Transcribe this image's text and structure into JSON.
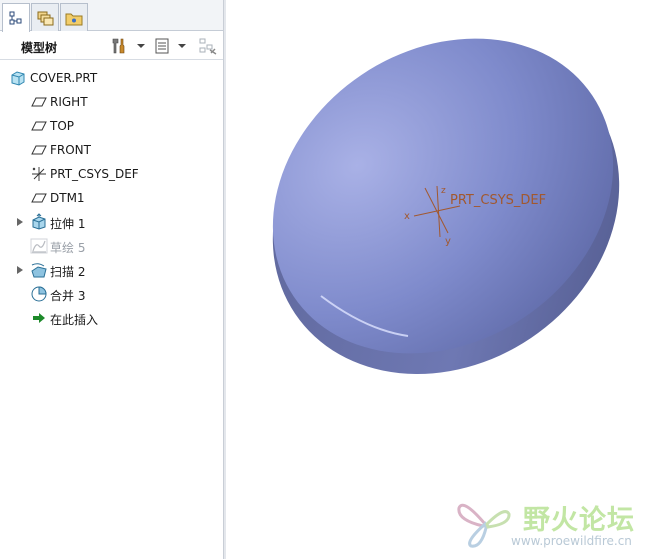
{
  "navigator": {
    "tabs": [
      {
        "icon": "model-tree-icon",
        "active": true
      },
      {
        "icon": "layers-icon",
        "active": false
      },
      {
        "icon": "favorites-folder-icon",
        "active": false
      }
    ],
    "toolbar": {
      "title": "模型树",
      "settings_icon": "tools-icon",
      "show_icon": "tree-columns-icon",
      "filter_icon": "tree-filter-icon"
    }
  },
  "tree": {
    "items": [
      {
        "label": "COVER.PRT",
        "icon": "part-icon",
        "expandable": false,
        "dim": false
      },
      {
        "label": "RIGHT",
        "icon": "datum-plane-icon",
        "expandable": false,
        "dim": false
      },
      {
        "label": "TOP",
        "icon": "datum-plane-icon",
        "expandable": false,
        "dim": false
      },
      {
        "label": "FRONT",
        "icon": "datum-plane-icon",
        "expandable": false,
        "dim": false
      },
      {
        "label": "PRT_CSYS_DEF",
        "icon": "coordinate-system-icon",
        "expandable": false,
        "dim": false
      },
      {
        "label": "DTM1",
        "icon": "datum-plane-icon",
        "expandable": false,
        "dim": false
      },
      {
        "label": "拉伸 1",
        "icon": "extrude-icon",
        "expandable": true,
        "dim": false
      },
      {
        "label": "草绘 5",
        "icon": "sketch-icon",
        "expandable": false,
        "dim": true
      },
      {
        "label": "扫描 2",
        "icon": "sweep-icon",
        "expandable": true,
        "dim": false
      },
      {
        "label": "合并 3",
        "icon": "merge-icon",
        "expandable": false,
        "dim": false
      },
      {
        "label": "在此插入",
        "icon": "insert-here-arrow-icon",
        "expandable": false,
        "dim": false
      }
    ]
  },
  "viewport": {
    "csys_label": "PRT_CSYS_DEF",
    "axis_x": "x",
    "axis_y": "y",
    "axis_z": "z",
    "model_color": "#7b87c8",
    "csys_color": "#a2582e"
  },
  "watermark": {
    "name": "野火论坛",
    "url": "www.proewildfire.cn"
  }
}
